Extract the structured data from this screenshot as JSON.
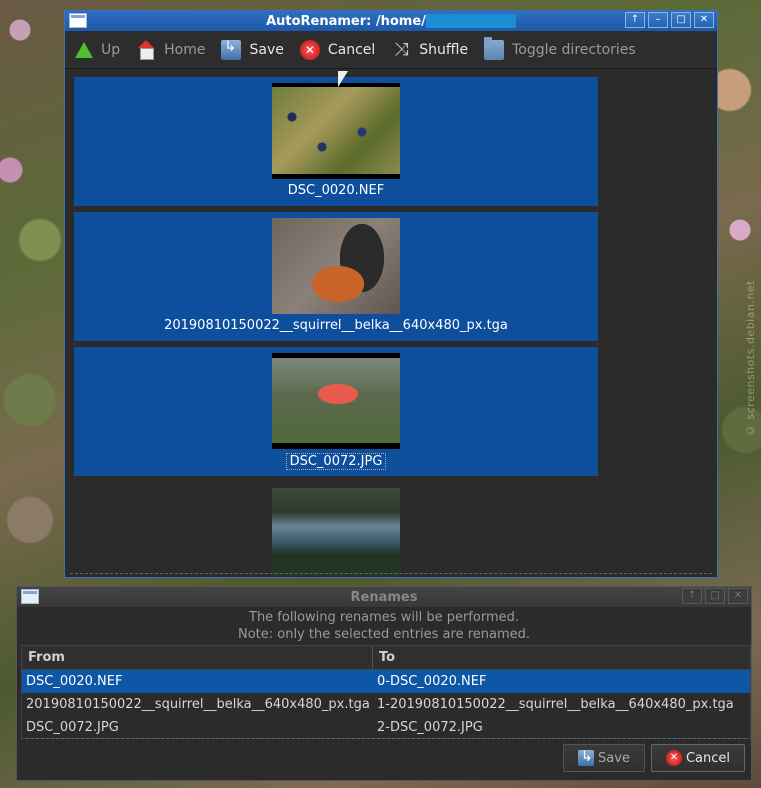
{
  "main_window": {
    "title": "AutoRenamer: /home/",
    "toolbar": {
      "up": "Up",
      "home": "Home",
      "save": "Save",
      "cancel": "Cancel",
      "shuffle": "Shuffle",
      "toggle_dirs": "Toggle directories"
    },
    "tiles": [
      {
        "label": "DSC_0020.NEF",
        "selected": true
      },
      {
        "label": "20190810150022__squirrel__belka__640x480_px.tga",
        "selected": true
      },
      {
        "label": "DSC_0072.JPG",
        "selected": true,
        "focused": true
      },
      {
        "label": "",
        "selected": false
      }
    ]
  },
  "renames_window": {
    "title": "Renames",
    "note_line1": "The following renames will be performed.",
    "note_line2": "Note: only the selected entries are renamed.",
    "columns": {
      "from": "From",
      "to": "To"
    },
    "rows": [
      {
        "from": "DSC_0020.NEF",
        "to": "0-DSC_0020.NEF",
        "selected": true
      },
      {
        "from": "20190810150022__squirrel__belka__640x480_px.tga",
        "to": "1-20190810150022__squirrel__belka__640x480_px.tga",
        "selected": false
      },
      {
        "from": "DSC_0072.JPG",
        "to": "2-DSC_0072.JPG",
        "selected": false
      }
    ],
    "buttons": {
      "save": "Save",
      "cancel": "Cancel"
    }
  },
  "watermark": "© screenshots.debian.net",
  "colors": {
    "accent": "#0e56a6",
    "titlebar": "#2466b8"
  }
}
